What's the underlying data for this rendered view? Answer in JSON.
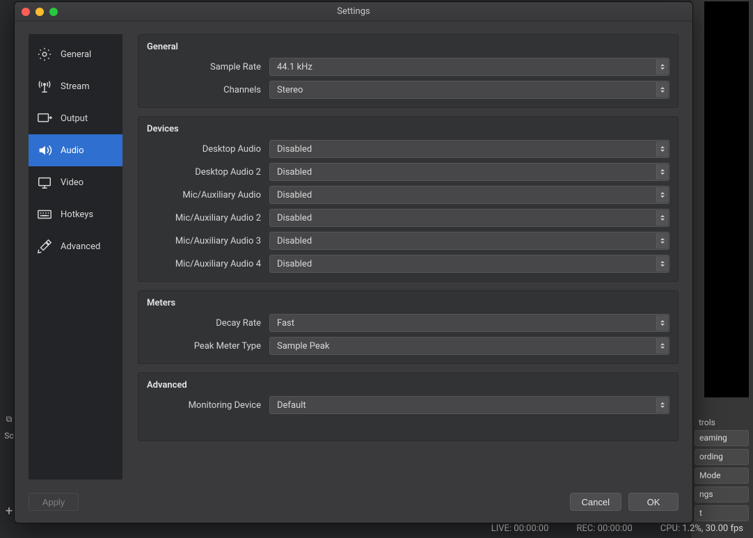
{
  "window": {
    "title": "Settings"
  },
  "sidebar": {
    "items": [
      {
        "label": "General"
      },
      {
        "label": "Stream"
      },
      {
        "label": "Output"
      },
      {
        "label": "Audio"
      },
      {
        "label": "Video"
      },
      {
        "label": "Hotkeys"
      },
      {
        "label": "Advanced"
      }
    ],
    "active_index": 3
  },
  "sections": {
    "general": {
      "title": "General",
      "sample_rate": {
        "label": "Sample Rate",
        "value": "44.1 kHz"
      },
      "channels": {
        "label": "Channels",
        "value": "Stereo"
      }
    },
    "devices": {
      "title": "Devices",
      "desktop_audio": {
        "label": "Desktop Audio",
        "value": "Disabled"
      },
      "desktop_audio_2": {
        "label": "Desktop Audio 2",
        "value": "Disabled"
      },
      "mic_aux": {
        "label": "Mic/Auxiliary Audio",
        "value": "Disabled"
      },
      "mic_aux_2": {
        "label": "Mic/Auxiliary Audio 2",
        "value": "Disabled"
      },
      "mic_aux_3": {
        "label": "Mic/Auxiliary Audio 3",
        "value": "Disabled"
      },
      "mic_aux_4": {
        "label": "Mic/Auxiliary Audio 4",
        "value": "Disabled"
      }
    },
    "meters": {
      "title": "Meters",
      "decay_rate": {
        "label": "Decay Rate",
        "value": "Fast"
      },
      "peak_meter_type": {
        "label": "Peak Meter Type",
        "value": "Sample Peak"
      }
    },
    "advanced": {
      "title": "Advanced",
      "monitoring_device": {
        "label": "Monitoring Device",
        "value": "Default"
      }
    }
  },
  "footer": {
    "apply": "Apply",
    "cancel": "Cancel",
    "ok": "OK"
  },
  "background": {
    "panel_label": "trols",
    "buttons": [
      "eaming",
      "ording",
      "Mode",
      "ngs",
      "t"
    ],
    "status": {
      "live": "LIVE: 00:00:00",
      "rec": "REC: 00:00:00",
      "cpu": "CPU: 1.2%, 30.00 fps"
    }
  }
}
